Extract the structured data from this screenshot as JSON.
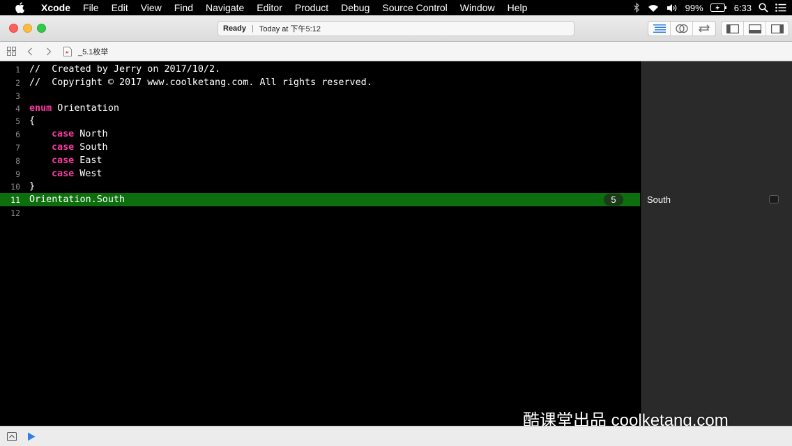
{
  "menubar": {
    "app_name": "Xcode",
    "items": [
      "File",
      "Edit",
      "View",
      "Find",
      "Navigate",
      "Editor",
      "Product",
      "Debug",
      "Source Control",
      "Window",
      "Help"
    ],
    "battery": "99%",
    "time": "6:33",
    "icons": [
      "apple-icon",
      "bluetooth-icon",
      "wifi-icon",
      "volume-icon",
      "battery-icon",
      "search-icon",
      "list-icon"
    ]
  },
  "toolbar": {
    "status": "Ready",
    "separator": "|",
    "timestamp": "Today at 下午5:12"
  },
  "jumpbar": {
    "file_name": "_5.1枚举"
  },
  "editor": {
    "lines": [
      {
        "num": "1",
        "text": "//  Created by Jerry on 2017/10/2."
      },
      {
        "num": "2",
        "text": "//  Copyright © 2017 www.coolketang.com. All rights reserved."
      },
      {
        "num": "3",
        "text": ""
      },
      {
        "num": "4",
        "kw": "enum",
        "rest": " Orientation"
      },
      {
        "num": "5",
        "text": "{"
      },
      {
        "num": "6",
        "kw": "case",
        "rest": " North"
      },
      {
        "num": "7",
        "kw": "case",
        "rest": " South"
      },
      {
        "num": "8",
        "kw": "case",
        "rest": " East"
      },
      {
        "num": "9",
        "kw": "case",
        "rest": " West"
      },
      {
        "num": "10",
        "text": "}"
      },
      {
        "num": "11",
        "text": "Orientation.South"
      },
      {
        "num": "12",
        "text": ""
      }
    ],
    "line_badge": "5"
  },
  "results": {
    "line11_value": "South"
  },
  "watermark": "酷课堂出品 coolketang.com",
  "colors": {
    "comment": "#23b223",
    "keyword": "#fa3aa2",
    "highlight": "#0c6e0c",
    "background": "#000000"
  }
}
